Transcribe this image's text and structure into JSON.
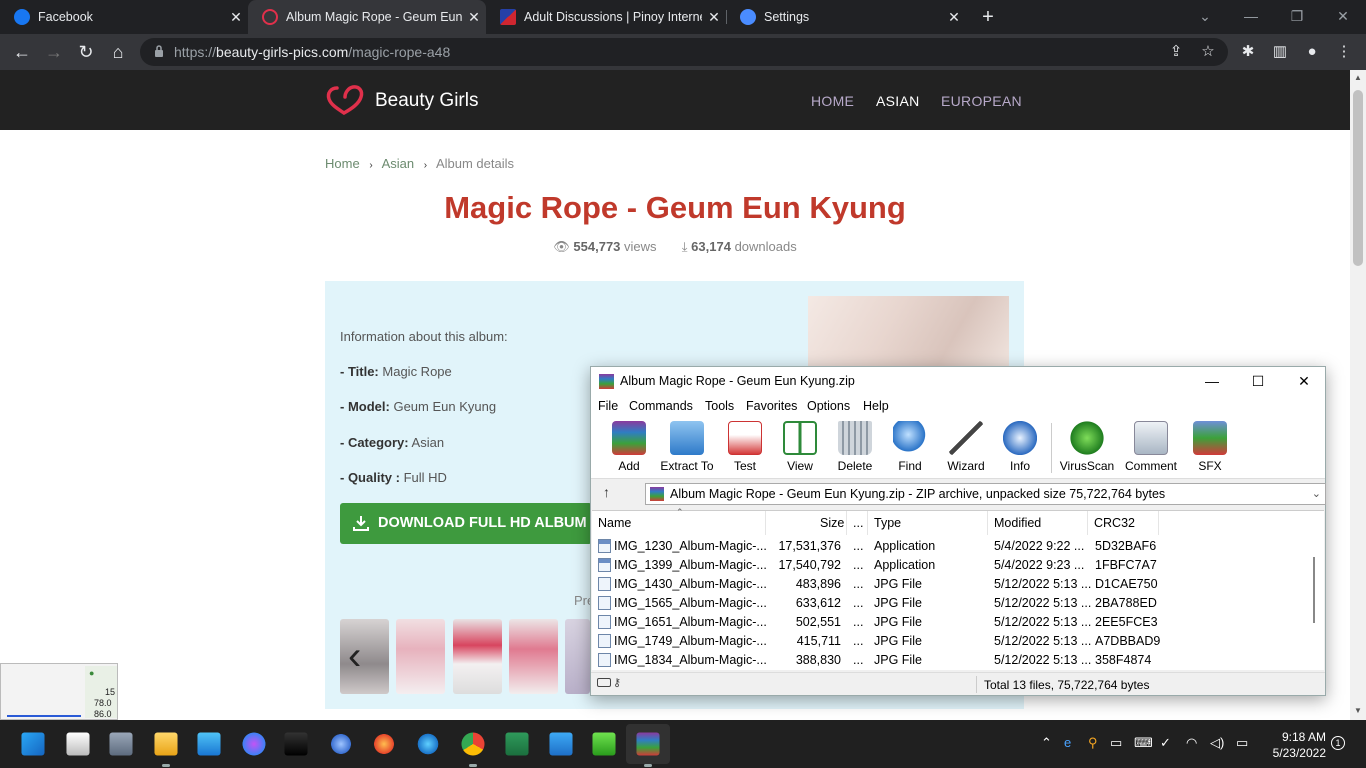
{
  "browser": {
    "tabs": [
      {
        "title": "Facebook",
        "icon": "facebook-icon"
      },
      {
        "title": "Album Magic Rope - Geum Eun K",
        "icon": "beauty-girls-icon"
      },
      {
        "title": "Adult Discussions | Pinoy Interne",
        "icon": "pinoy-icon"
      },
      {
        "title": "Settings",
        "icon": "gear-icon"
      }
    ],
    "new_tab_label": "+",
    "url_prefix": "https://",
    "url_domain": "beauty-girls-pics.com",
    "url_path": "/magic-rope-a48"
  },
  "site": {
    "logo_text": "Beauty Girls",
    "nav": [
      "HOME",
      "ASIAN",
      "EUROPEAN"
    ],
    "breadcrumb": [
      "Home",
      "Asian",
      "Album details"
    ],
    "title": "Magic Rope - Geum Eun Kyung",
    "views_count": "554,773",
    "views_label": "views",
    "downloads_count": "63,174",
    "downloads_label": "downloads",
    "info_heading": "Information about this album:",
    "info": [
      {
        "label": "- Title:",
        "value": "Magic Rope"
      },
      {
        "label": "- Model:",
        "value": "Geum Eun Kyung"
      },
      {
        "label": "- Category:",
        "value": "Asian"
      },
      {
        "label": "- Quality :",
        "value": "Full HD"
      }
    ],
    "download_button": "DOWNLOAD FULL HD ALBUM",
    "preview_partial": "Pre",
    "prev_arrow": "‹",
    "accent": "#c0392b",
    "button_color": "#3e9a3e"
  },
  "winrar": {
    "title": "Album Magic Rope - Geum Eun Kyung.zip",
    "menu": [
      "File",
      "Commands",
      "Tools",
      "Favorites",
      "Options",
      "Help"
    ],
    "tools": [
      "Add",
      "Extract To",
      "Test",
      "View",
      "Delete",
      "Find",
      "Wizard",
      "Info",
      "VirusScan",
      "Comment",
      "SFX"
    ],
    "path": "Album Magic Rope - Geum Eun Kyung.zip - ZIP archive, unpacked size 75,722,764 bytes",
    "columns": [
      "Name",
      "Size",
      "...",
      "Type",
      "Modified",
      "CRC32"
    ],
    "files": [
      {
        "name": "IMG_1230_Album-Magic-...",
        "size": "17,531,376",
        "dots": "...",
        "type": "Application",
        "modified": "5/4/2022 9:22 ...",
        "crc": "5D32BAF6",
        "kind": "app"
      },
      {
        "name": "IMG_1399_Album-Magic-...",
        "size": "17,540,792",
        "dots": "...",
        "type": "Application",
        "modified": "5/4/2022 9:23 ...",
        "crc": "1FBFC7A7",
        "kind": "app"
      },
      {
        "name": "IMG_1430_Album-Magic-...",
        "size": "483,896",
        "dots": "...",
        "type": "JPG File",
        "modified": "5/12/2022 5:13 ...",
        "crc": "D1CAE750",
        "kind": "jpg"
      },
      {
        "name": "IMG_1565_Album-Magic-...",
        "size": "633,612",
        "dots": "...",
        "type": "JPG File",
        "modified": "5/12/2022 5:13 ...",
        "crc": "2BA788ED",
        "kind": "jpg"
      },
      {
        "name": "IMG_1651_Album-Magic-...",
        "size": "502,551",
        "dots": "...",
        "type": "JPG File",
        "modified": "5/12/2022 5:13 ...",
        "crc": "2EE5FCE3",
        "kind": "jpg"
      },
      {
        "name": "IMG_1749_Album-Magic-...",
        "size": "415,711",
        "dots": "...",
        "type": "JPG File",
        "modified": "5/12/2022 5:13 ...",
        "crc": "A7DBBAD9",
        "kind": "jpg"
      },
      {
        "name": "IMG_1834_Album-Magic-...",
        "size": "388,830",
        "dots": "...",
        "type": "JPG File",
        "modified": "5/12/2022 5:13 ...",
        "crc": "358F4874",
        "kind": "jpg"
      }
    ],
    "status": "Total 13 files, 75,722,764 bytes"
  },
  "widget": {
    "values": [
      "15",
      "78.0",
      "86.0"
    ]
  },
  "taskbar": {
    "time": "9:18 AM",
    "date": "5/23/2022",
    "notifications": "1",
    "apps": [
      "start-icon",
      "task-view-icon",
      "camera-icon",
      "file-explorer-icon",
      "store-icon",
      "messenger-icon",
      "terminal-icon",
      "settings-icon",
      "firefox-icon",
      "edge-icon",
      "chrome-icon",
      "excel-icon",
      "notepad-icon",
      "xampp-icon",
      "winrar-icon"
    ]
  }
}
